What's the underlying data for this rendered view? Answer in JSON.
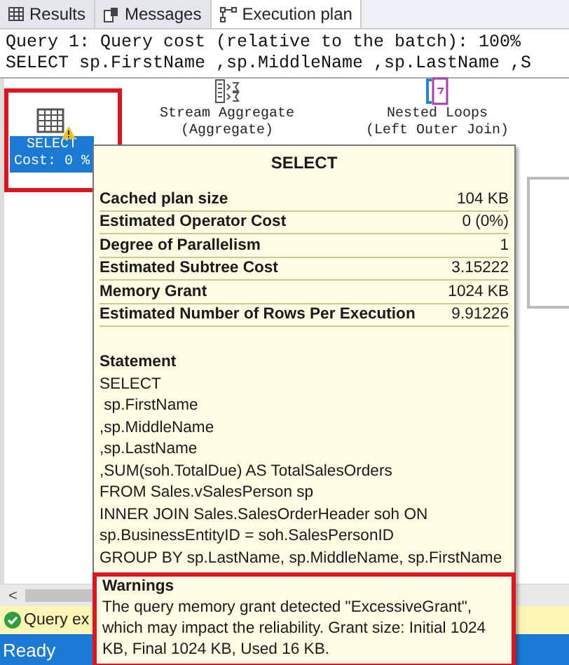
{
  "tabs": [
    {
      "label": "Results",
      "kind": "grid",
      "selected": false
    },
    {
      "label": "Messages",
      "kind": "messages",
      "selected": false
    },
    {
      "label": "Execution plan",
      "kind": "plan",
      "selected": true
    }
  ],
  "query_header": [
    "Query 1: Query cost (relative to the batch): 100%",
    "SELECT sp.FirstName ,sp.MiddleName ,sp.LastName ,S"
  ],
  "plan": {
    "nodes": [
      {
        "kind": "select",
        "lines": [
          "SELECT",
          "Cost: 0 %"
        ],
        "selected": true,
        "warning": true
      },
      {
        "kind": "aggregate",
        "lines": [
          "Stream Aggregate",
          "(Aggregate)"
        ],
        "selected": false,
        "warning": false
      },
      {
        "kind": "loops",
        "lines": [
          "Nested Loops",
          "(Left Outer Join)"
        ],
        "selected": false,
        "warning": false
      }
    ]
  },
  "tooltip": {
    "title": "SELECT",
    "properties": [
      {
        "name": "Cached plan size",
        "value": "104 KB"
      },
      {
        "name": "Estimated Operator Cost",
        "value": "0 (0%)"
      },
      {
        "name": "Degree of Parallelism",
        "value": "1"
      },
      {
        "name": "Estimated Subtree Cost",
        "value": "3.15222"
      },
      {
        "name": "Memory Grant",
        "value": "1024 KB"
      },
      {
        "name": "Estimated Number of Rows Per Execution",
        "value": "9.91226"
      }
    ],
    "statement": {
      "heading": "Statement",
      "lines": [
        "SELECT",
        " sp.FirstName",
        ",sp.MiddleName",
        ",sp.LastName",
        ",SUM(soh.TotalDue) AS TotalSalesOrders",
        "FROM Sales.vSalesPerson sp",
        "INNER JOIN Sales.SalesOrderHeader soh ON",
        "sp.BusinessEntityID = soh.SalesPersonID",
        "GROUP BY sp.LastName, sp.MiddleName, sp.FirstName"
      ]
    },
    "warnings": {
      "heading": "Warnings",
      "text": "The query memory grant detected \"ExcessiveGrant\", which may impact the reliability. Grant size: Initial 1024 KB, Final 1024 KB, Used 16 KB."
    }
  },
  "scrollbar": {
    "left_arrow": "<"
  },
  "status_message": "Query ex",
  "status_bar": "Ready"
}
